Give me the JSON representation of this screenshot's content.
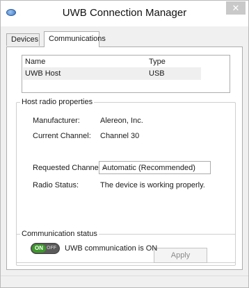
{
  "window": {
    "title": "UWB Connection Manager"
  },
  "tabs": [
    {
      "label": "Devices"
    },
    {
      "label": "Communications"
    }
  ],
  "device_list": {
    "columns": [
      "Name",
      "Type"
    ],
    "rows": [
      {
        "name": "UWB Host",
        "type": "USB"
      }
    ]
  },
  "host_radio": {
    "title": "Host radio properties",
    "manufacturer_label": "Manufacturer:",
    "manufacturer_value": "Alereon, Inc.",
    "current_channel_label": "Current Channel:",
    "current_channel_value": "Channel 30",
    "requested_channel_label": "Requested Channel:",
    "requested_channel_value": "Automatic (Recommended)",
    "radio_status_label": "Radio Status:",
    "radio_status_value": "The device is working properly.",
    "apply_label": "Apply"
  },
  "comm_status": {
    "title": "Communication status",
    "toggle_on": "ON",
    "toggle_off": "OFF",
    "status_text": "UWB communication is ON"
  }
}
